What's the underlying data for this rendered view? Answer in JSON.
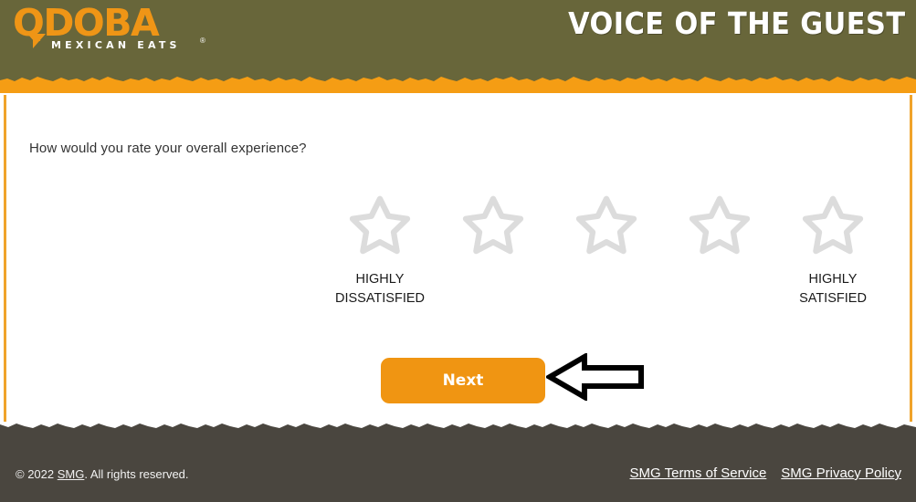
{
  "header": {
    "brand_name": "QDOBA",
    "brand_tagline": "MEXICAN EATS",
    "brand_tm": "®",
    "program_title": "VOICE OF THE GUEST",
    "colors": {
      "header_bg": "#68663a",
      "brand_orange": "#ef9516",
      "band_orange": "#f59d14"
    }
  },
  "survey": {
    "question": "How would you rate your overall experience?",
    "rating": {
      "icon": "star-outline-icon",
      "count": 5,
      "selected": 0,
      "star_color": "#dcdcdc",
      "scale_low_label": "HIGHLY\nDISSATISFIED",
      "scale_low_line1": "HIGHLY",
      "scale_low_line2": "DISSATISFIED",
      "scale_high_line1": "HIGHLY",
      "scale_high_line2": "SATISFIED"
    },
    "next_button": {
      "label": "Next",
      "color": "#f09512"
    },
    "annotation": {
      "icon": "left-arrow-icon",
      "points_to": "Next"
    }
  },
  "footer": {
    "copyright_prefix": "© 2022 ",
    "copyright_link": "SMG",
    "copyright_suffix": ". All rights reserved.",
    "links": [
      {
        "label": "SMG Terms of Service"
      },
      {
        "label": "SMG Privacy Policy"
      }
    ],
    "bg_color": "#4a463f"
  }
}
